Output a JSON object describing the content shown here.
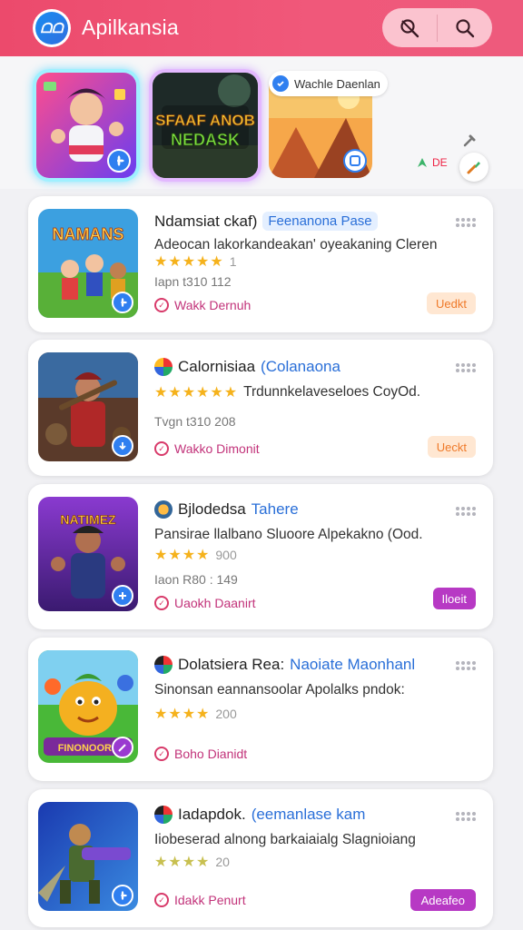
{
  "header": {
    "logo_text": "ᗝᗝ",
    "title": "Apilkansia"
  },
  "featured": {
    "tile_2_text_top": "SFAAF ANOB",
    "tile_2_text_bottom": "NEDASK",
    "tag_label": "Wachle Daenlan",
    "mini_label": "DE"
  },
  "apps": [
    {
      "title": "Ndamsiat ckaf)",
      "subtitle": "Feenanona Pase",
      "subtitle_style": "chip",
      "description": "Adeocan lakorkandeakan' oyeakaning Cleren",
      "stars": "★★★★★",
      "rating_text": "1",
      "meta": "Iapn t310 112",
      "developer": "Wakk Dernuh",
      "action": "Uedkt",
      "action_style": "orange",
      "thumb_text": "NAMANS"
    },
    {
      "title": "Calornisiaa",
      "subtitle": "(Colanaona",
      "subtitle_style": "plain",
      "description": "Trdunnkelaveseloes CoyOd.",
      "stars": "★★★★★★",
      "rating_text": "",
      "meta": "Tvgn t310 208",
      "developer": "Wakko Dimonit",
      "action": "Ueckt",
      "action_style": "orange",
      "thumb_text": ""
    },
    {
      "title": "Bjlodedsa",
      "subtitle": "Tahere",
      "subtitle_style": "plain",
      "description": "Pansirae llalbano Sluoore Alpekakno (Ood.",
      "stars": "★★★★",
      "rating_text": "900",
      "meta": "Iaon R80 : 149",
      "developer": "Uaokh Daanirt",
      "action": "Iloeit",
      "action_style": "purple",
      "thumb_text": "NATIMEZ"
    },
    {
      "title": "Dolatsiera Rea:",
      "subtitle": "Naoiate Maonhanl",
      "subtitle_style": "plain",
      "description": "Sinonsan eannansoolar Apolalks pndok:",
      "stars": "★★★★",
      "rating_text": "200",
      "meta": "",
      "developer": "Boho Dianidt",
      "action": "",
      "action_style": "none",
      "thumb_text": "FINONOORE"
    },
    {
      "title": "Iadapdok.",
      "subtitle": "(eemanlase kam",
      "subtitle_style": "plain",
      "description": "Iiobeserad alnong barkaiaialg Slagnioiang",
      "stars": "★★★★",
      "rating_text": "20",
      "meta": "",
      "developer": "Idakk Penurt",
      "action": "Adeafeo",
      "action_style": "purple",
      "thumb_text": ""
    }
  ],
  "colors": {
    "header": "#ee5275",
    "accent_blue": "#2a6fd8",
    "star": "#f5b21c",
    "developer": "#c2337a",
    "action_orange_bg": "#ffe7d2",
    "action_purple_bg": "#b739c4"
  }
}
